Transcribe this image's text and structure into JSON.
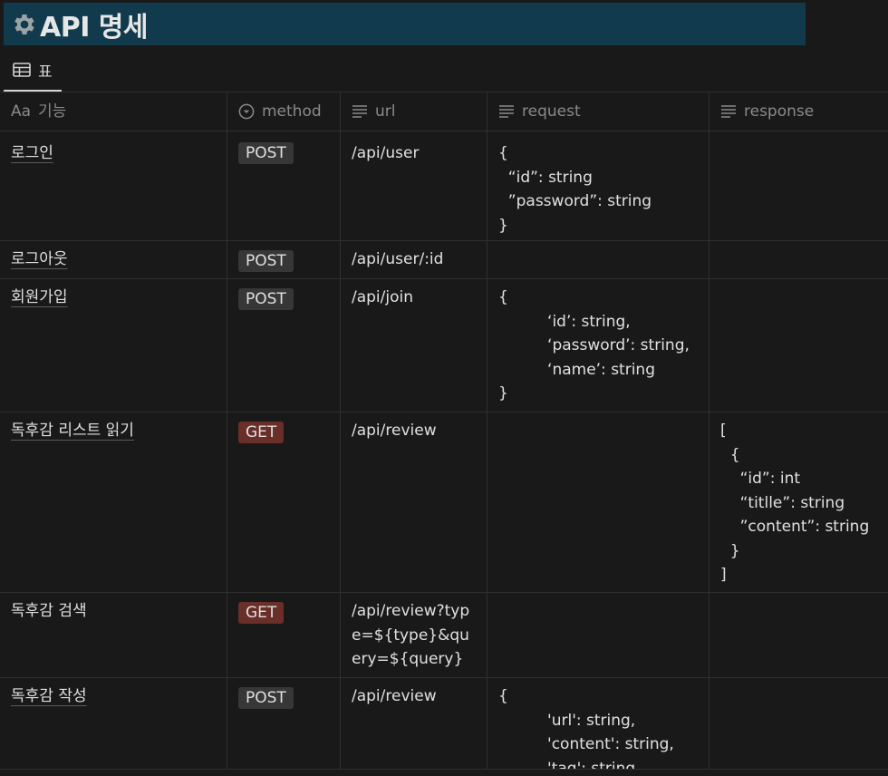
{
  "page": {
    "title": "API 명세",
    "title_icon": "gear-icon",
    "accent": "#113a4d"
  },
  "view_tab": {
    "label": "표",
    "icon": "table-icon"
  },
  "columns": [
    {
      "label": "기능",
      "icon": "title-aa-icon"
    },
    {
      "label": "method",
      "icon": "select-icon"
    },
    {
      "label": "url",
      "icon": "text-lines-icon"
    },
    {
      "label": "request",
      "icon": "text-lines-icon"
    },
    {
      "label": "response",
      "icon": "text-lines-icon"
    }
  ],
  "tag_colors": {
    "POST": "#373737",
    "GET": "#6a2f28"
  },
  "rows": [
    {
      "name": "로그인",
      "method": "POST",
      "url": "/api/user",
      "request": "{\n  “id”: string\n  ”password”: string\n}",
      "response": ""
    },
    {
      "name": "로그아웃",
      "method": "POST",
      "url": "/api/user/:id",
      "request": "",
      "response": ""
    },
    {
      "name": "회원가입",
      "method": "POST",
      "url": "/api/join",
      "request": "{\n          ‘id’: string,\n          ‘password’: string,\n          ‘name’: string\n}",
      "response": ""
    },
    {
      "name": "독후감 리스트 읽기",
      "method": "GET",
      "url": "/api/review",
      "request": "",
      "response": "[\n  {\n    “id”: int\n    “titlle”: string\n    ”content”: string\n  }\n]"
    },
    {
      "name": "독후감 검색",
      "method": "GET",
      "url": "/api/review?type=${type}&query=${query}",
      "request": "",
      "response": ""
    },
    {
      "name": "독후감 작성",
      "method": "POST",
      "url": "/api/review",
      "request": "{\n          'url': string,\n          'content': string,\n          'tag': string",
      "response": ""
    }
  ]
}
